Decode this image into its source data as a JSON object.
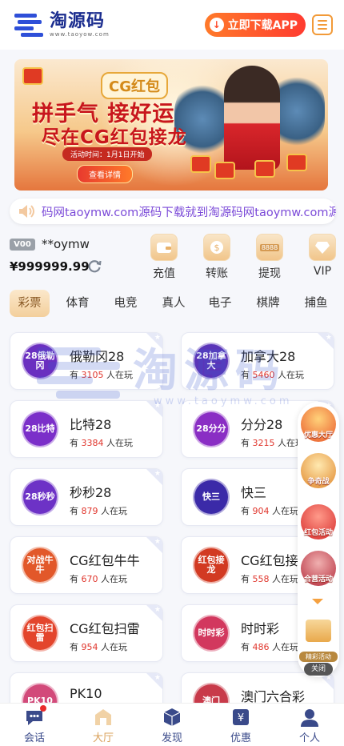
{
  "header": {
    "logo_cn": "淘源码",
    "logo_url": "www.taoyow.com",
    "download_label": "立即下载APP"
  },
  "banner": {
    "logo": "CG红包",
    "line1": "拼手气 接好运",
    "line2": "尽在CG红包接龙",
    "time": "活动时间：1月1日开始",
    "button": "查看详情"
  },
  "marquee": {
    "text": "码网taoymw.com源码下载就到淘源码网taoymw.com源"
  },
  "user": {
    "vip_level": "V00",
    "username": "**oymw",
    "balance": "¥999999.99"
  },
  "actions": [
    {
      "label": "充值",
      "icon": "wallet-icon"
    },
    {
      "label": "转账",
      "icon": "transfer-icon"
    },
    {
      "label": "提现",
      "icon": "atm-icon",
      "icon_text": "8888"
    },
    {
      "label": "VIP",
      "icon": "diamond-icon"
    }
  ],
  "tabs": [
    "彩票",
    "体育",
    "电竞",
    "真人",
    "电子",
    "棋牌",
    "捕鱼"
  ],
  "active_tab": "彩票",
  "games": [
    {
      "name": "俄勒冈28",
      "icon_text": "28俄勒冈",
      "players": "3105",
      "color": "#6a2fc0"
    },
    {
      "name": "加拿大28",
      "icon_text": "28加拿大",
      "players": "5460",
      "color": "#5a35b8"
    },
    {
      "name": "比特28",
      "icon_text": "28比特",
      "players": "3384",
      "color": "#7b2fc9"
    },
    {
      "name": "分分28",
      "icon_text": "28分分",
      "players": "3215",
      "color": "#8a2ec4"
    },
    {
      "name": "秒秒28",
      "icon_text": "28秒秒",
      "players": "879",
      "color": "#6d32c6"
    },
    {
      "name": "快三",
      "icon_text": "快三",
      "players": "904",
      "color": "#3b2aa8"
    },
    {
      "name": "CG红包牛牛",
      "icon_text": "对战牛牛",
      "players": "670",
      "color": "#e2582a"
    },
    {
      "name": "CG红包接龙",
      "icon_text": "红包接龙",
      "players": "558",
      "color": "#d23a22"
    },
    {
      "name": "CG红包扫雷",
      "icon_text": "红包扫雷",
      "players": "954",
      "color": "#e3452c"
    },
    {
      "name": "时时彩",
      "icon_text": "时时彩",
      "players": "486",
      "color": "#d2385e"
    },
    {
      "name": "PK10",
      "icon_text": "PK10",
      "players": "",
      "color": "#d24a7a"
    },
    {
      "name": "澳门六合彩",
      "icon_text": "澳门",
      "players": "",
      "color": "#c83a4a"
    }
  ],
  "players_prefix": "有",
  "players_suffix": "人在玩",
  "watermark": {
    "cn": "淘源码",
    "url": "www.taoymw.com"
  },
  "floater": {
    "promos": [
      "优惠大厅",
      "争奇战",
      "红包活动",
      "合营活动"
    ],
    "gift_label": "精彩活动",
    "close_label": "关闭"
  },
  "bottom_nav": [
    {
      "label": "会话",
      "icon": "chat-icon"
    },
    {
      "label": "大厅",
      "icon": "hall-icon"
    },
    {
      "label": "发现",
      "icon": "cube-icon"
    },
    {
      "label": "优惠",
      "icon": "promo-icon"
    },
    {
      "label": "个人",
      "icon": "user-icon"
    }
  ],
  "active_nav": "大厅",
  "colors": {
    "brand": "#1b2d8f",
    "accent": "#ff4a2a",
    "gold": "#d9a05a",
    "marquee": "#7b4ad8",
    "player_count": "#e0362d"
  }
}
